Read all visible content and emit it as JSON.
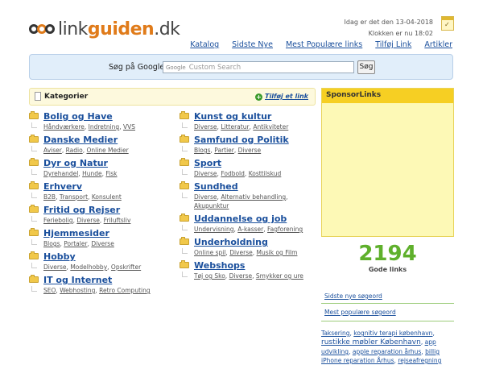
{
  "logo": {
    "part1": "link",
    "part2": "guiden",
    "part3": ".dk"
  },
  "date": {
    "line1": "Idag er det den 13-04-2018",
    "line2": "Klokken er nu 18:02"
  },
  "nav": [
    "Katalog",
    "Sidste Nye",
    "Mest Populære links",
    "Tilføj Link",
    "Artikler"
  ],
  "search": {
    "label": "Søg på Google",
    "brand": "Google",
    "placeholder": "Custom Search",
    "button": "Søg"
  },
  "categories_box": {
    "title": "Kategorier",
    "add_link": "Tilføj et link"
  },
  "categories_left": [
    {
      "title": "Bolig og Have",
      "subs": [
        "Håndværkere",
        "Indretning",
        "VVS"
      ]
    },
    {
      "title": "Danske Medier",
      "subs": [
        "Aviser",
        "Radio",
        "Online Medier"
      ]
    },
    {
      "title": "Dyr og Natur",
      "subs": [
        "Dyrehandel",
        "Hunde",
        "Fisk"
      ]
    },
    {
      "title": "Erhverv",
      "subs": [
        "B2B",
        "Transport",
        "Konsulent"
      ]
    },
    {
      "title": "Fritid og Rejser",
      "subs": [
        "Feriebolig",
        "Diverse",
        "Friluftsliv"
      ]
    },
    {
      "title": "Hjemmesider",
      "subs": [
        "Blogs",
        "Portaler",
        "Diverse"
      ]
    },
    {
      "title": "Hobby",
      "subs": [
        "Diverse",
        "Modelhobby",
        "Opskrifter"
      ]
    },
    {
      "title": "IT og Internet",
      "subs": [
        "SEO",
        "Webhosting",
        "Retro Computing"
      ]
    }
  ],
  "categories_right": [
    {
      "title": "Kunst og kultur",
      "subs": [
        "Diverse",
        "Litteratur",
        "Antikviteter"
      ]
    },
    {
      "title": "Samfund og Politik",
      "subs": [
        "Blogs",
        "Partier",
        "Diverse"
      ]
    },
    {
      "title": "Sport",
      "subs": [
        "Diverse",
        "Fodbold",
        "Kosttilskud"
      ]
    },
    {
      "title": "Sundhed",
      "subs": [
        "Diverse",
        "Alternativ behandling",
        "Akupunktur"
      ]
    },
    {
      "title": "Uddannelse og job",
      "subs": [
        "Undervisning",
        "A-kasser",
        "Fagforening"
      ]
    },
    {
      "title": "Underholdning",
      "subs": [
        "Online spil",
        "Diverse",
        "Musik og Film"
      ]
    },
    {
      "title": "Webshops",
      "subs": [
        "Tøj og Sko",
        "Diverse",
        "Smykker og ure"
      ]
    }
  ],
  "sponsor": {
    "title": "SponsorLinks"
  },
  "count": {
    "value": "2194",
    "label": "Gode links"
  },
  "side_links": {
    "latest": "Sidste nye søgeord",
    "popular": "Mest populære søgeord"
  },
  "tags": [
    "Taksering",
    "kognitiv terapi københavn",
    "rustikke møbler København",
    "app udvikling",
    "apple reparation århus",
    "billig iPhone reparation Århus",
    "rejseafregning"
  ]
}
